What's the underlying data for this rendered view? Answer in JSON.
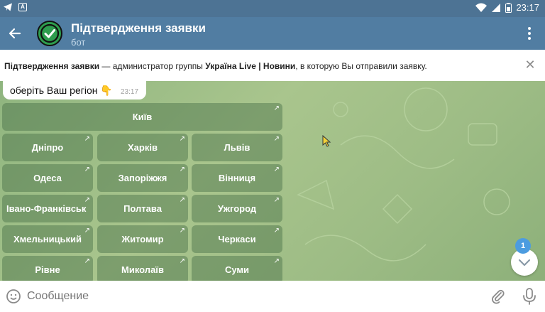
{
  "status_bar": {
    "time": "23:17"
  },
  "header": {
    "title": "Підтвердження заявки",
    "subtitle": "бот"
  },
  "pinned": {
    "bot_name": "Підтвердження заявки",
    "text_1": " — администратор группы ",
    "group_name": "Україна Live | Новини",
    "text_2": ", в которую Вы отправили заявку."
  },
  "message": {
    "text": "оберіть Ваш регіон 👇",
    "time": "23:17"
  },
  "keyboard": {
    "rows": [
      [
        "Київ"
      ],
      [
        "Дніпро",
        "Харків",
        "Львів"
      ],
      [
        "Одеса",
        "Запоріжжя",
        "Вінниця"
      ],
      [
        "Івано-Франківськ",
        "Полтава",
        "Ужгород"
      ],
      [
        "Хмельницький",
        "Житомир",
        "Черкаси"
      ],
      [
        "Рівне",
        "Миколаїв",
        "Суми"
      ]
    ]
  },
  "scroll_badge": "1",
  "composer": {
    "placeholder": "Сообщение"
  },
  "colors": {
    "header": "#517da2",
    "accent_badge": "#4c9ce0"
  }
}
